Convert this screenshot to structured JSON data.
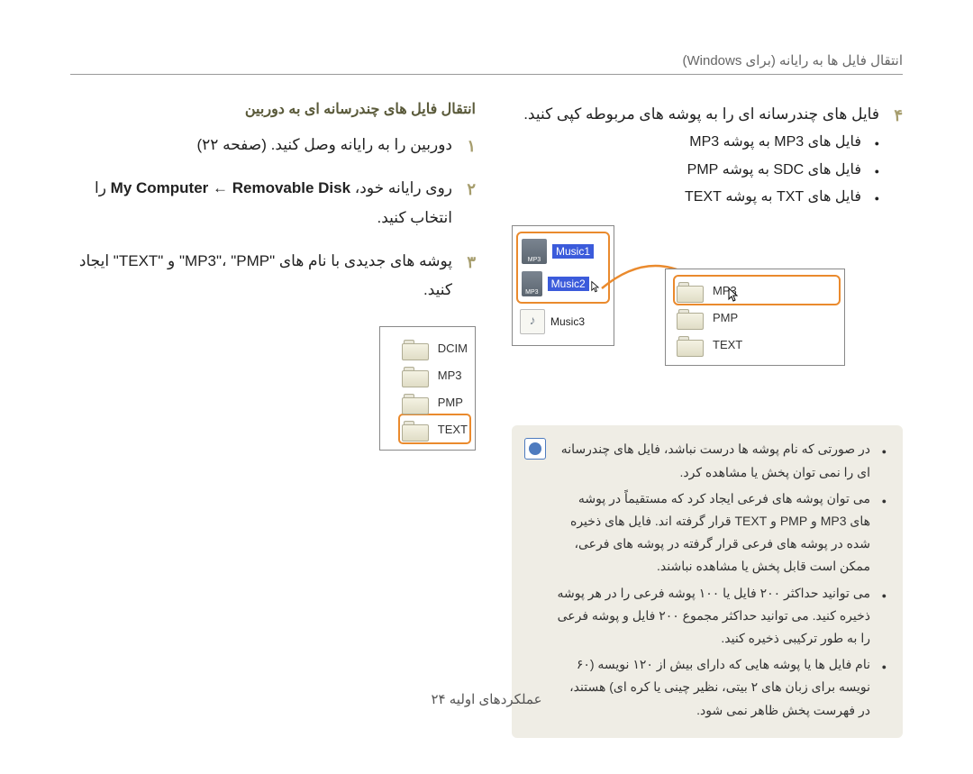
{
  "header": "انتقال فایل ها به رایانه (برای Windows)",
  "right_col": {
    "subheading": "انتقال فایل های چندرسانه ای به دوربین",
    "steps": [
      {
        "num": "۱",
        "text": "دوربین را به رایانه وصل کنید. (صفحه ۲۲)"
      },
      {
        "num": "۲",
        "text_pre": "روی رایانه خود، ",
        "text_mid": "My Computer ← Removable Disk",
        "text_post": " را انتخاب کنید."
      },
      {
        "num": "۳",
        "text": "پوشه های جدیدی با نام های \"MP3\"، \"PMP\" و \"TEXT\" ایجاد کنید."
      }
    ],
    "folders": [
      "DCIM",
      "MP3",
      "PMP",
      "TEXT"
    ]
  },
  "left_col": {
    "step4_num": "۴",
    "step4_text": "فایل های چندرسانه ای را به پوشه های مربوطه کپی کنید.",
    "sub_items": [
      "فایل های MP3 به پوشه MP3",
      "فایل های SDC به پوشه PMP",
      "فایل های TXT به پوشه TEXT"
    ],
    "music_items": [
      "Music1",
      "Music2",
      "Music3"
    ],
    "dest_folders": [
      "MP3",
      "PMP",
      "TEXT"
    ]
  },
  "notes": [
    "در صورتی که نام پوشه ها درست نباشد، فایل های چندرسانه ای را نمی توان پخش یا مشاهده کرد.",
    "می توان پوشه های فرعی ایجاد کرد که مستقیماً در پوشه های MP3 و PMP و TEXT قرار گرفته اند. فایل های ذخیره شده در پوشه های فرعی قرار گرفته در پوشه های فرعی، ممکن است قابل پخش یا مشاهده نباشند.",
    "می توانید حداکثر ۲۰۰ فایل یا ۱۰۰ پوشه فرعی را در هر پوشه ذخیره کنید. می توانید حداکثر مجموع ۲۰۰ فایل و پوشه فرعی را به طور ترکیبی ذخیره کنید.",
    "نام فایل ها یا پوشه هایی که دارای بیش از ۱۲۰ نویسه (۶۰ نویسه برای زبان های ۲ بیتی، نظیر چینی یا کره ای) هستند، در فهرست پخش ظاهر نمی شود."
  ],
  "footer": "عملکردهای اولیه ۲۴"
}
